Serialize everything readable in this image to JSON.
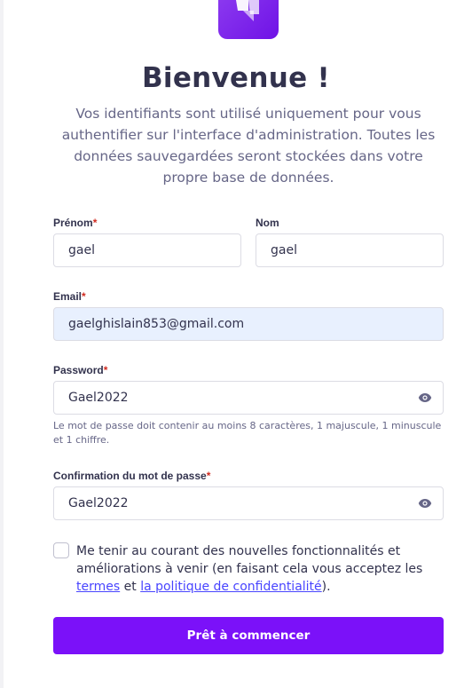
{
  "header": {
    "title": "Bienvenue !",
    "subtitle": "Vos identifiants sont utilisé uniquement pour vous authentifier sur l'interface d'administration. Toutes les données sauvegardées seront stockées dans votre propre base de données."
  },
  "form": {
    "firstname": {
      "label": "Prénom",
      "required": "*",
      "value": "gael"
    },
    "lastname": {
      "label": "Nom",
      "value": "gael"
    },
    "email": {
      "label": "Email",
      "required": "*",
      "value": "gaelghislain853@gmail.com"
    },
    "password": {
      "label": "Password",
      "required": "*",
      "value": "Gael2022",
      "hint": "Le mot de passe doit contenir au moins 8 caractères, 1 majuscule, 1 minuscule et 1 chiffre."
    },
    "confirm_password": {
      "label": "Confirmation du mot de passe",
      "required": "*",
      "value": "Gael2022"
    },
    "news": {
      "text_before": "Me tenir au courant des nouvelles fonctionnalités et améliorations à venir (en faisant cela vous acceptez les ",
      "terms_link": "termes",
      "text_middle": " et ",
      "privacy_link": "la politique de confidentialité",
      "text_after": ").",
      "checked": false
    },
    "submit_label": "Prêt à commencer"
  },
  "icons": {
    "logo": "strapi-logo",
    "password_toggle": "eye-icon"
  },
  "colors": {
    "primary": "#7b11f9",
    "link": "#4945ff",
    "required": "#d02b20",
    "autofill": "#e8f0fe"
  }
}
